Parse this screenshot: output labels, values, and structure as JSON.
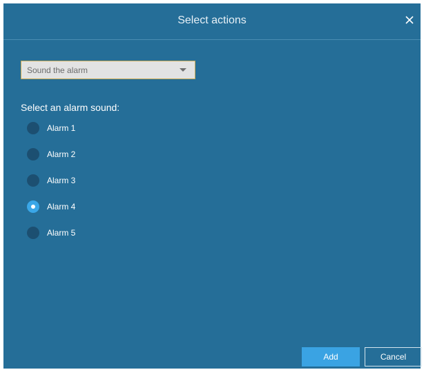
{
  "dialog": {
    "title": "Select actions",
    "close_icon": "close-icon"
  },
  "action_select": {
    "value": "Sound the alarm",
    "caret_icon": "caret-down-icon"
  },
  "alarm_section": {
    "label": "Select an alarm sound:",
    "options": [
      {
        "label": "Alarm 1",
        "checked": false
      },
      {
        "label": "Alarm 2",
        "checked": false
      },
      {
        "label": "Alarm 3",
        "checked": false
      },
      {
        "label": "Alarm 4",
        "checked": true
      },
      {
        "label": "Alarm 5",
        "checked": false
      }
    ]
  },
  "footer": {
    "add_label": "Add",
    "cancel_label": "Cancel"
  },
  "colors": {
    "dialog_bg": "#256e98",
    "radio_unchecked": "#1c4f71",
    "radio_checked": "#3aa7e8",
    "add_button": "#3aa3e3"
  }
}
